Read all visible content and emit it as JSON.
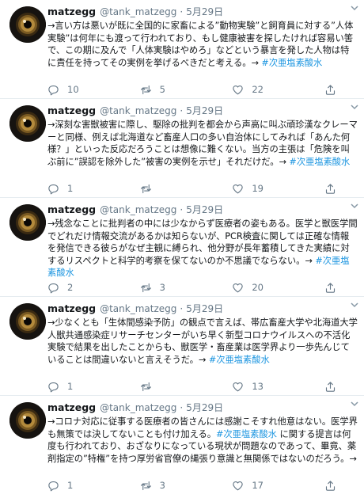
{
  "tweets": [
    {
      "name": "matzegg",
      "handle": "@tank_matzegg",
      "separator": "·",
      "date": "5月29日",
      "body": "→言い方は悪いが既に全国的に家畜による”動物実験”と飼育員に対する”人体実験”は何年にも渡って行われており、もし健康被害を探したければ容易い筈で、この期に及んで「人体実験はやめろ」などという暴言を発した人物は特に責任を持ってその実例を挙げるべきだと考える。→",
      "hashtag": "#次亜塩素酸水",
      "replies": "10",
      "retweets": "5",
      "likes": "22"
    },
    {
      "name": "matzegg",
      "handle": "@tank_matzegg",
      "separator": "·",
      "date": "5月29日",
      "body": "→深刻な害獣被害に際し、駆除の批判を都会から声高に叫ぶ頑珍漢なクレーマーと同様、例えば北海道など畜産人口の多い自治体にしてみれば「あんた何様？」といった反応だろうことは想像に難くない。当方の主張は「危険を叫ぶ前に”誤認を除外した”被害の実例を示せ」それだけだ。→",
      "hashtag": "#次亜塩素酸水",
      "replies": "1",
      "retweets": "",
      "likes": "19"
    },
    {
      "name": "matzegg",
      "handle": "@tank_matzegg",
      "separator": "·",
      "date": "5月29日",
      "body": "→残念なことに批判者の中には少なからず医療者の姿もある。医学と獣医学間でどれだけ情報交流があるかは知らないが、PCR検査に関しては正確な情報を発信できる彼らがなぜ主観に縛られ、他分野が長年蓄積してきた実績に対するリスペクトと科学的考察を保てないのか不思議でならない。→",
      "hashtag": "#次亜塩素酸水",
      "replies": "2",
      "retweets": "3",
      "likes": "20"
    },
    {
      "name": "matzegg",
      "handle": "@tank_matzegg",
      "separator": "·",
      "date": "5月29日",
      "body": "→少なくとも「生体間感染予防」の観点で言えば、帯広畜産大学や北海道大学人獣共通感染症リサーチセンターがいち早く新型コロナウイルスへの不活化実験で結果を出したことからも、獣医学・畜産業は医学界より一歩先んじていることは間違いないと言えそうだ。→",
      "hashtag": "#次亜塩素酸水",
      "replies": "1",
      "retweets": "",
      "likes": "13"
    },
    {
      "name": "matzegg",
      "handle": "@tank_matzegg",
      "separator": "·",
      "date": "5月29日",
      "body_pre": "→コロナ対応に従事する医療者の皆さんには感謝こそすれ他意はない。医学界も無策では決してないことも付け加える。",
      "hashtag": "#次亜塩素酸水",
      "body_post": " に関する提言は何度も行われており、おざなりになっている現状が問題なのであって、畢竟、薬剤指定の”特権”を持つ厚労省官僚の縄張り意識と無関係ではないのだろう。→",
      "replies": "1",
      "retweets": "3",
      "likes": "17"
    }
  ],
  "icons": {
    "reply": "reply-icon",
    "retweet": "retweet-icon",
    "like": "heart-icon",
    "share": "share-icon",
    "menu": "chevron-down-icon"
  },
  "colors": {
    "hashtag": "#1b95e0",
    "muted": "#657786",
    "text": "#14171a",
    "divider": "#e6ecf0"
  }
}
